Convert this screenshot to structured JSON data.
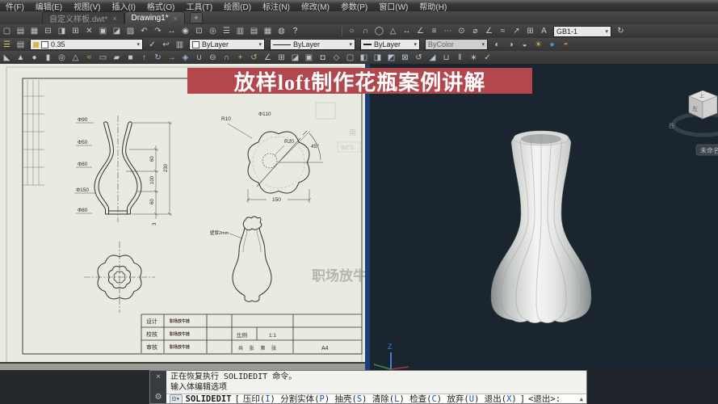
{
  "menu": {
    "items": [
      "件(F)",
      "编辑(E)",
      "视图(V)",
      "插入(I)",
      "格式(O)",
      "工具(T)",
      "绘图(D)",
      "标注(N)",
      "修改(M)",
      "参数(P)",
      "窗口(W)",
      "帮助(H)"
    ]
  },
  "tabs": {
    "items": [
      {
        "label": "自定义样板.dwt*",
        "close": "×"
      },
      {
        "label": "Drawing1*",
        "close": "×"
      }
    ],
    "new_tab": "+"
  },
  "toolbar": {
    "layer_value": "0.35",
    "color_value": "ByLayer",
    "linetype_value": "ByLayer",
    "lineweight_value": "ByLayer",
    "plotstyle_value": "ByColor",
    "dim_style_value": "GB1-1",
    "carat": "▾"
  },
  "toolbar_icons": {
    "row1_left": [
      "new",
      "open",
      "save",
      "print",
      "plot-preview",
      "publish",
      "cut",
      "copy",
      "paste",
      "match-properties",
      "undo",
      "redo",
      "pan",
      "zoom-realtime",
      "zoom-window",
      "zoom-previous",
      "properties",
      "design-center",
      "tool-palettes",
      "sheet-set-manager",
      "render",
      "help"
    ],
    "row1_right": [
      "circle",
      "arc",
      "ellipse",
      "polygon",
      "dim-linear",
      "dim-aligned",
      "dim-baseline",
      "dim-continue",
      "dim-radius",
      "dim-diameter",
      "dim-angular",
      "quick-dim",
      "leader",
      "tolerance",
      "dim-edit"
    ],
    "row1_after": [
      "dim-update"
    ],
    "row2_left": [
      "layer-properties",
      "layer-states"
    ],
    "row2_mid": [
      "make-current",
      "layer-previous",
      "layer-isolate"
    ],
    "row2_right": [
      "render-presets",
      "hide",
      "visual-styles",
      "lights",
      "materials",
      "render-region"
    ],
    "row3": [
      "wedge",
      "cone",
      "sphere",
      "cylinder",
      "torus",
      "pyramid",
      "helix",
      "planar-surface",
      "polysolid",
      "box",
      "extrude",
      "revolve",
      "sweep",
      "loft",
      "union",
      "subtract",
      "intersect",
      "3d-move",
      "3d-rotate",
      "3d-align",
      "3d-array",
      "slice",
      "thicken",
      "imprint",
      "color-edges",
      "copy-edges",
      "extrude-faces",
      "move-faces",
      "offset-faces",
      "delete-faces",
      "rotate-faces",
      "taper-faces",
      "shell",
      "separate",
      "clean",
      "check"
    ]
  },
  "banner": {
    "title": "放样loft制作花瓶案例讲解"
  },
  "colors": {
    "banner_bg": "#b2484e",
    "viewport3d_bg": "#1a2530",
    "divider_blue": "#1b3f74",
    "command_option_blue": "#1553c8",
    "paper_bg": "#e9eae1"
  },
  "drawing": {
    "profile_dims": {
      "d1": "Φ90",
      "d2": "Φ50",
      "d3": "Φ80",
      "d4": "Φ150",
      "d5": "Φ80",
      "h1": "60",
      "h2": "100",
      "h3": "60",
      "total": "230",
      "base": "3"
    },
    "section_dims": {
      "r_lobe": "R10",
      "dia": "Φ110",
      "r_inner": "R20",
      "angle": "45°",
      "width": "150"
    },
    "sketch_note": "壁厚2mm",
    "watermark": "职场放牛娃",
    "ghost_compass_south": "南",
    "ghost_ucs_label": "WCS",
    "titleblock": {
      "row1_label": "设计",
      "row2_label": "校核",
      "row3_label": "审核",
      "name": "职场放牛娃",
      "scale_label": "比例",
      "scale_value": "1:1",
      "sheet_label": "共 张 第 张",
      "paper_size": "A4"
    }
  },
  "viewport3d": {
    "view_label": "未命名视图",
    "cube_left": "左",
    "cube_top": "上",
    "compass_west": "西",
    "axis_z": "Z"
  },
  "command": {
    "history": [
      "正在恢复执行 SOLIDEDIT 命令。",
      "输入体编辑选项"
    ],
    "close_icon": "×",
    "tool_icon_hint": "customize",
    "prompt_cmd": "SOLIDEDIT",
    "bracket_open": "[",
    "options": [
      "压印(I)",
      "分割实体(P)",
      "抽壳(S)",
      "清除(L)",
      "检查(C)",
      "放弃(U)",
      "退出(X)"
    ],
    "bracket_close": "]",
    "default_option": "<退出>:",
    "scroll_up": "▲"
  }
}
